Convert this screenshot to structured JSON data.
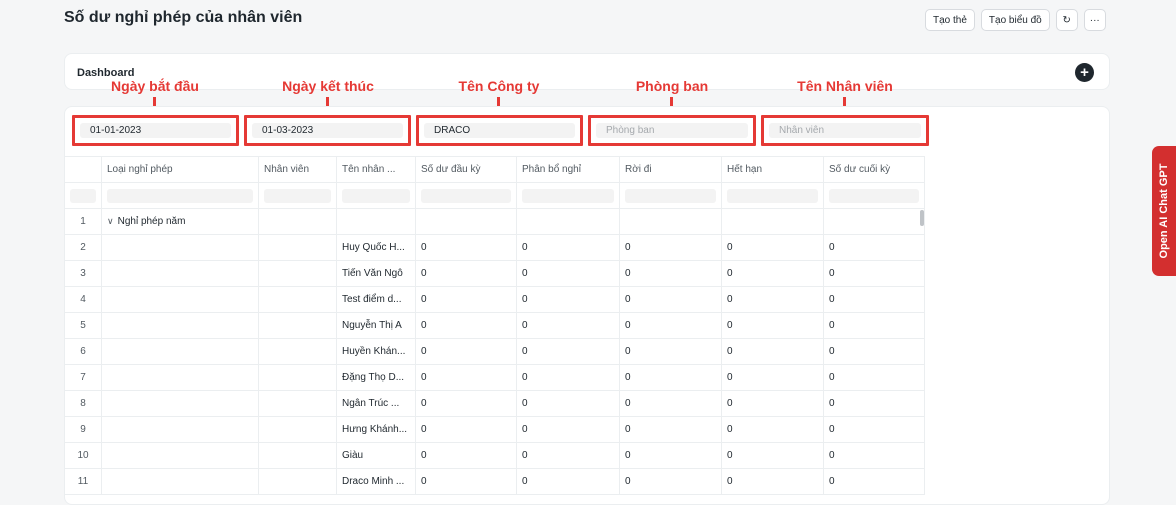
{
  "page": {
    "title": "Số dư nghỉ phép của nhân viên"
  },
  "toolbar": {
    "create_card": "Tạo thẻ",
    "create_chart": "Tạo biểu đồ",
    "refresh_icon": "↻",
    "more_icon": "···"
  },
  "dashboard": {
    "label": "Dashboard",
    "add_icon": "+"
  },
  "annotations": {
    "start_date": "Ngày bắt đầu",
    "end_date": "Ngày kết thúc",
    "company": "Tên Công ty",
    "department": "Phòng ban",
    "employee_name": "Tên Nhân viên",
    "color": "#e53935"
  },
  "filters": {
    "from_date": "01-01-2023",
    "to_date": "01-03-2023",
    "company": "DRACO",
    "department_placeholder": "Phòng ban",
    "employee_placeholder": "Nhân viên"
  },
  "table": {
    "columns": [
      "Loại nghỉ phép",
      "Nhân viên",
      "Tên nhân ...",
      "Số dư đầu kỳ",
      "Phân bổ nghỉ",
      "Rời đi",
      "Hết hạn",
      "Số dư cuối kỳ"
    ],
    "rows": [
      {
        "n": "1",
        "type": "Nghỉ phép năm",
        "employee": "",
        "name": "",
        "v": [
          "",
          "",
          "",
          "",
          ""
        ]
      },
      {
        "n": "2",
        "type": "",
        "employee": "",
        "name": "Huy Quốc H...",
        "v": [
          "0",
          "0",
          "0",
          "0",
          "0"
        ]
      },
      {
        "n": "3",
        "type": "",
        "employee": "",
        "name": "Tiến Văn Ngô",
        "v": [
          "0",
          "0",
          "0",
          "0",
          "0"
        ]
      },
      {
        "n": "4",
        "type": "",
        "employee": "",
        "name": "Test điểm d...",
        "v": [
          "0",
          "0",
          "0",
          "0",
          "0"
        ]
      },
      {
        "n": "5",
        "type": "",
        "employee": "",
        "name": "Nguyễn Thị A",
        "v": [
          "0",
          "0",
          "0",
          "0",
          "0"
        ]
      },
      {
        "n": "6",
        "type": "",
        "employee": "",
        "name": "Huyền Khán...",
        "v": [
          "0",
          "0",
          "0",
          "0",
          "0"
        ]
      },
      {
        "n": "7",
        "type": "",
        "employee": "",
        "name": "Đặng Thọ D...",
        "v": [
          "0",
          "0",
          "0",
          "0",
          "0"
        ]
      },
      {
        "n": "8",
        "type": "",
        "employee": "",
        "name": "Ngân Trúc ...",
        "v": [
          "0",
          "0",
          "0",
          "0",
          "0"
        ]
      },
      {
        "n": "9",
        "type": "",
        "employee": "",
        "name": "Hưng Khánh...",
        "v": [
          "0",
          "0",
          "0",
          "0",
          "0"
        ]
      },
      {
        "n": "10",
        "type": "",
        "employee": "",
        "name": "Giàu",
        "v": [
          "0",
          "0",
          "0",
          "0",
          "0"
        ]
      },
      {
        "n": "11",
        "type": "",
        "employee": "",
        "name": "Draco Minh ...",
        "v": [
          "0",
          "0",
          "0",
          "0",
          "0"
        ]
      }
    ]
  },
  "side_tab": {
    "label": "Open AI Chat GPT",
    "color": "#d32f2f"
  },
  "icons": {
    "expand": "chevron-down-icon",
    "refresh": "refresh-icon",
    "more": "more-icon",
    "add": "plus-icon"
  }
}
